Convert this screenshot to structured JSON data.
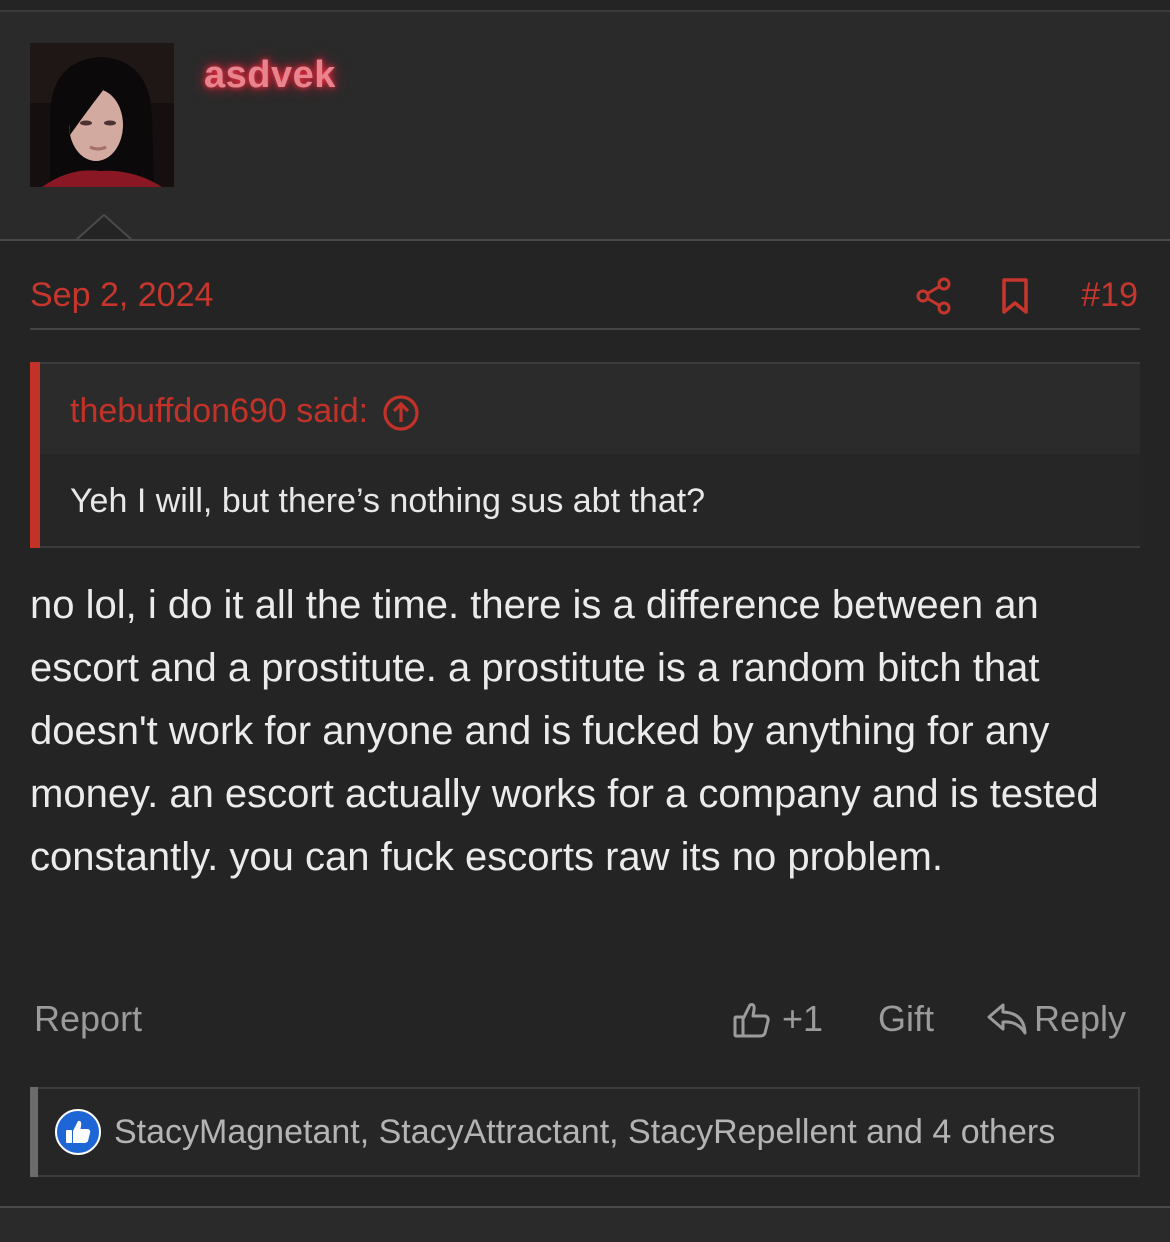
{
  "user": {
    "username": "asdvek",
    "avatar_icon": "user-avatar-photo",
    "name_color": "#e7848d",
    "glow_color": "#ff2f45"
  },
  "post": {
    "date": "Sep 2, 2024",
    "number": "#19",
    "body": "no lol, i do it all the time. there is a difference between an escort and a prostitute. a prostitute is a random bitch that doesn't work for anyone and is fucked by anything for any money. an escort actually works for a company and is tested constantly. you can fuck escorts raw its no problem.",
    "meta_icons": [
      "share-icon",
      "bookmark-icon"
    ],
    "accent_color": "#c6362d"
  },
  "quote": {
    "author_label": "thebuffdon690 said:",
    "text": "Yeh I will, but there’s nothing sus abt that?",
    "icon": "arrow-up-circle-icon"
  },
  "actions": {
    "report": "Report",
    "like_count": "+1",
    "gift": "Gift",
    "reply": "Reply"
  },
  "reactions": {
    "icon": "thumbs-up-badge-icon",
    "text": "StacyMagnetant, StacyAttractant, StacyRepellent and 4 others"
  }
}
